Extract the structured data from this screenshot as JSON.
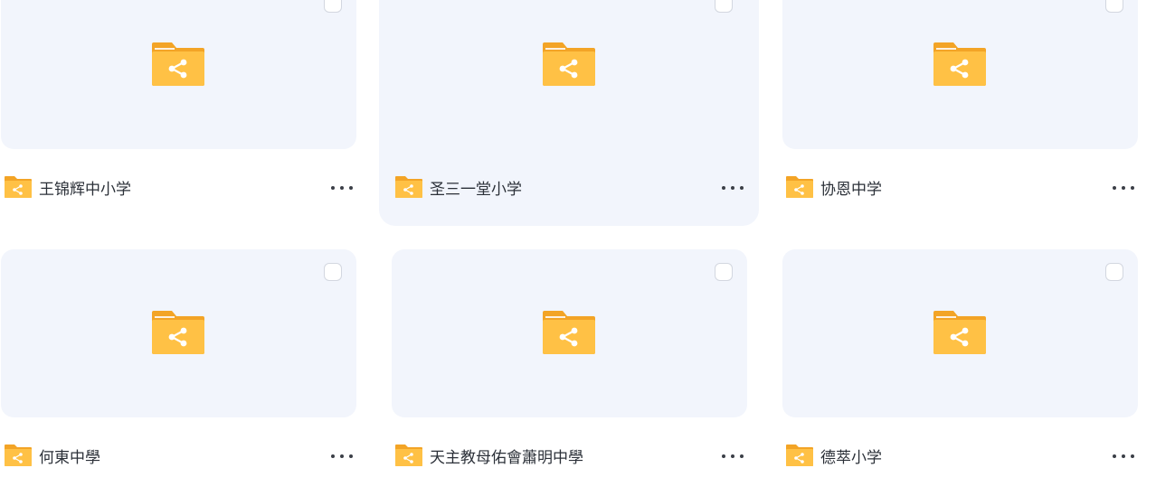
{
  "colors": {
    "card_bg": "#f2f5fc",
    "folder_back": "#f3a426",
    "folder_front": "#ffc145",
    "text": "#2b3038"
  },
  "icons": {
    "folder": "shared-folder-icon",
    "more": "more-icon",
    "checkbox": "checkbox-icon"
  },
  "folders": [
    {
      "name": "王锦辉中小学"
    },
    {
      "name": "圣三一堂小学",
      "hovered": true
    },
    {
      "name": "协恩中学"
    },
    {
      "name": "何東中學"
    },
    {
      "name": "天主教母佑會蕭明中學"
    },
    {
      "name": "德萃小学"
    }
  ]
}
